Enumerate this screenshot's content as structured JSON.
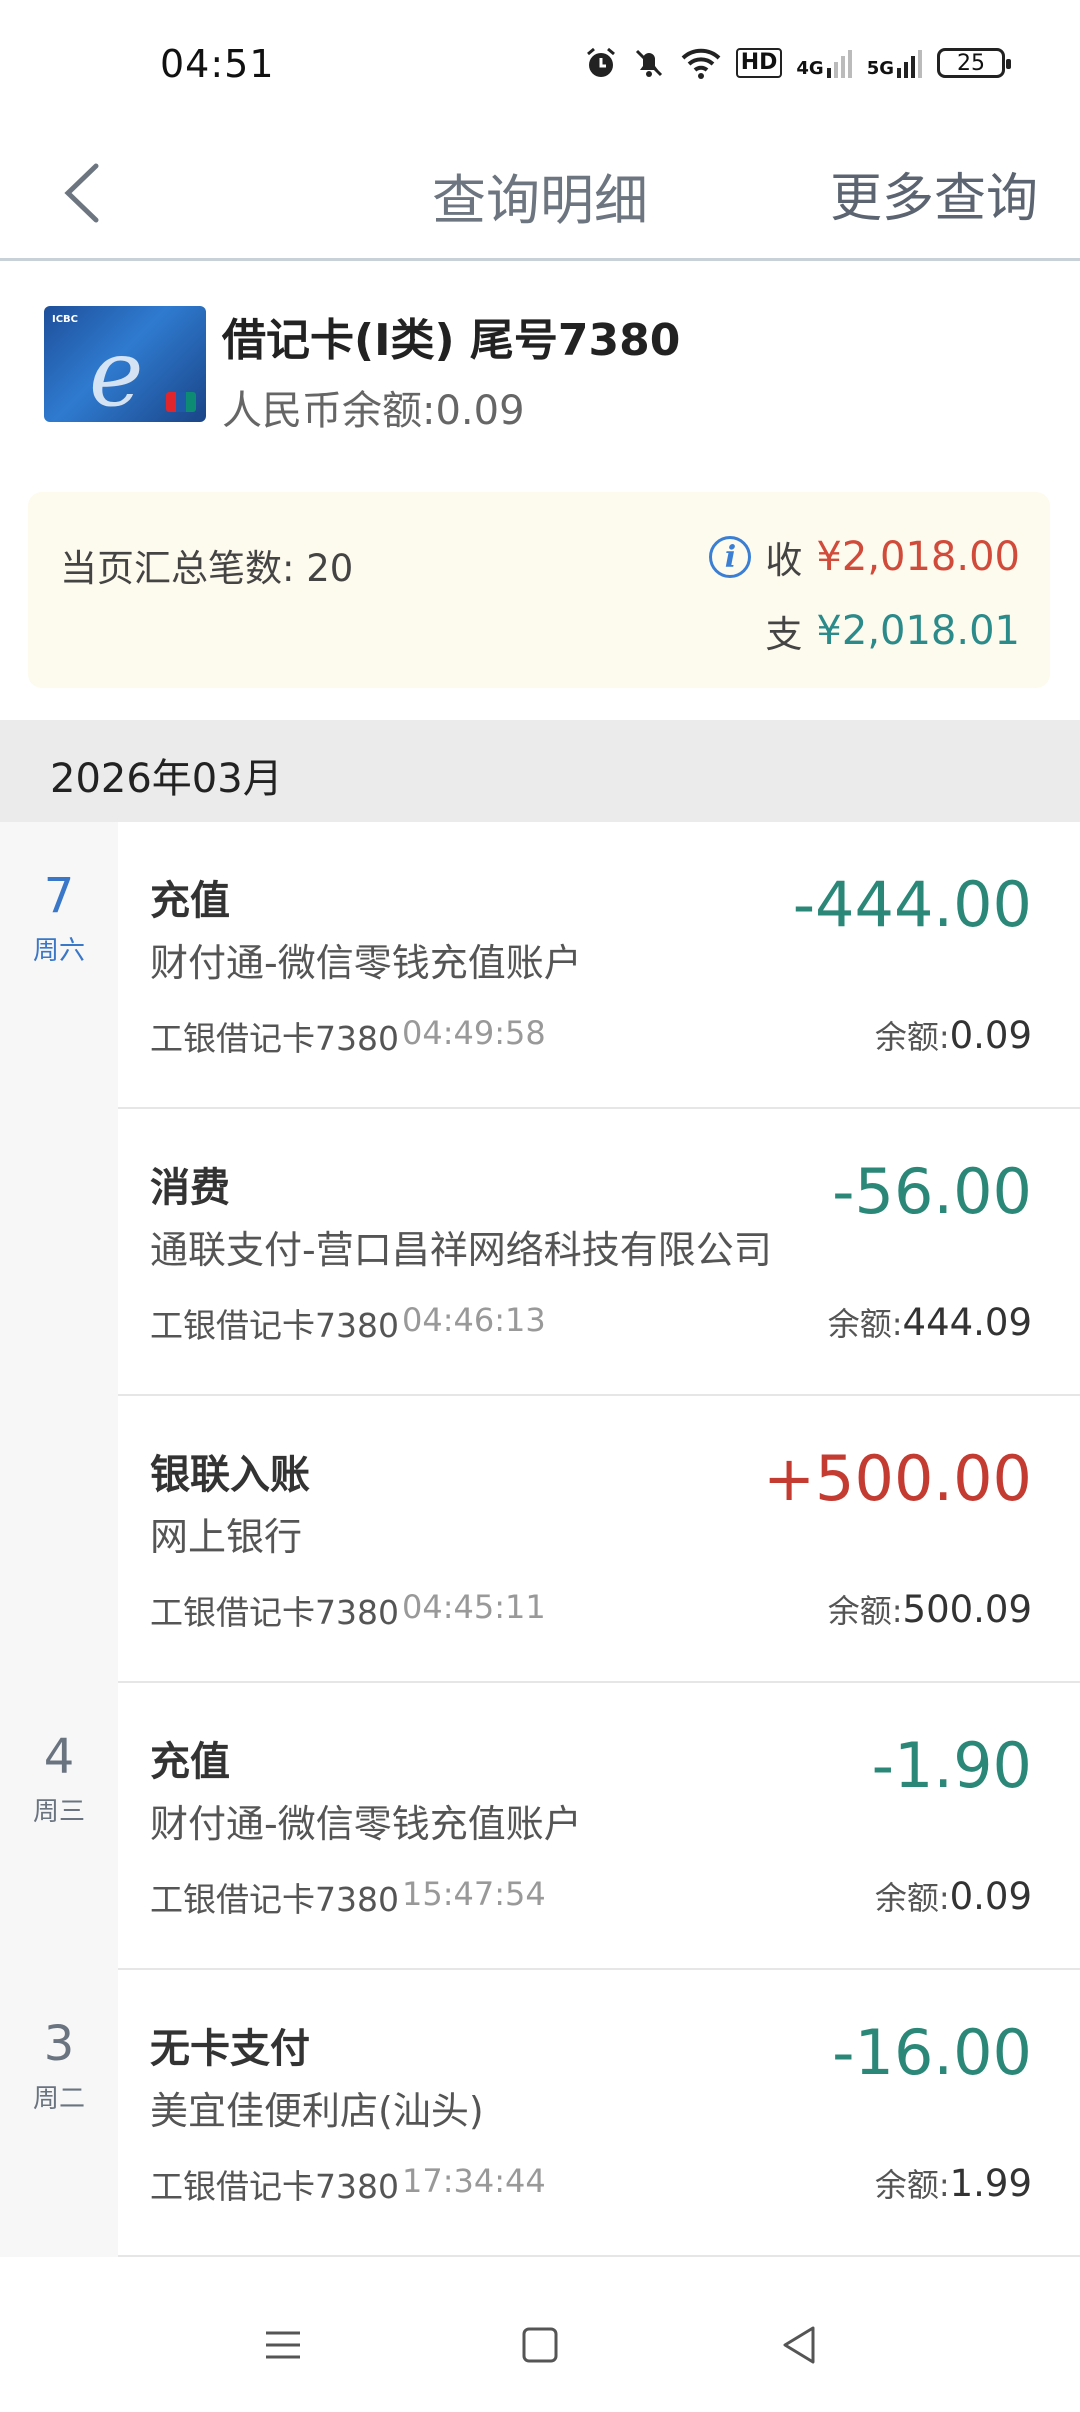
{
  "status": {
    "time": "04:51",
    "battery": "25",
    "net_hd": "HD",
    "net_4g": "4G",
    "net_5g": "5G"
  },
  "nav": {
    "title": "查询明细",
    "more": "更多查询"
  },
  "card": {
    "name": "借记卡(I类) 尾号7380",
    "balance": "人民币余额:0.09"
  },
  "summary": {
    "count": "当页汇总笔数: 20",
    "in_label": "收",
    "in_amount": "¥2,018.00",
    "out_label": "支",
    "out_amount": "¥2,018.01"
  },
  "month": "2026年03月",
  "groups": [
    {
      "day": "7",
      "weekday": "周六",
      "active": true,
      "items": [
        {
          "type": "充值",
          "desc": "财付通-微信零钱充值账户",
          "card": "工银借记卡7380",
          "time": "04:49:58",
          "amount": "-444.00",
          "balance_label": "余额:",
          "balance": "0.09"
        },
        {
          "type": "消费",
          "desc": "通联支付-营口昌祥网络科技有限公司",
          "card": "工银借记卡7380",
          "time": "04:46:13",
          "amount": "-56.00",
          "balance_label": "余额:",
          "balance": "444.09"
        },
        {
          "type": "银联入账",
          "desc": "网上银行",
          "card": "工银借记卡7380",
          "time": "04:45:11",
          "amount": "+500.00",
          "balance_label": "余额:",
          "balance": "500.09"
        }
      ]
    },
    {
      "day": "4",
      "weekday": "周三",
      "active": false,
      "items": [
        {
          "type": "充值",
          "desc": "财付通-微信零钱充值账户",
          "card": "工银借记卡7380",
          "time": "15:47:54",
          "amount": "-1.90",
          "balance_label": "余额:",
          "balance": "0.09"
        }
      ]
    },
    {
      "day": "3",
      "weekday": "周二",
      "active": false,
      "items": [
        {
          "type": "无卡支付",
          "desc": "美宜佳便利店(汕头)",
          "card": "工银借记卡7380",
          "time": "17:34:44",
          "amount": "-16.00",
          "balance_label": "余额:",
          "balance": "1.99"
        }
      ]
    }
  ],
  "colors": {
    "negative": "#2b8878",
    "positive": "#c43b32",
    "accent": "#3a77c9"
  }
}
